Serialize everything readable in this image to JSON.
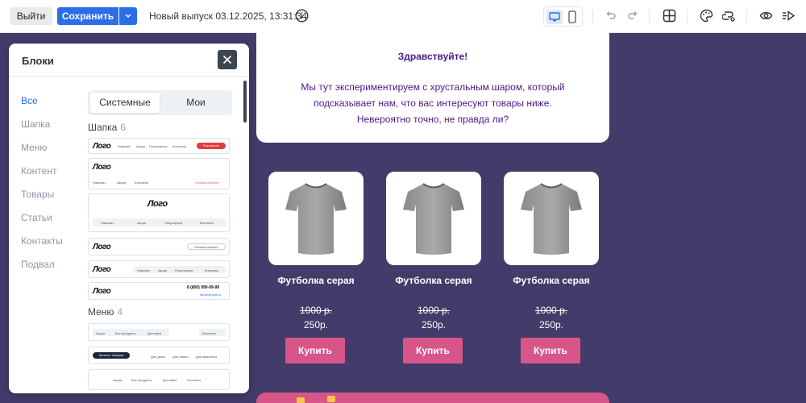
{
  "toolbar": {
    "exit_label": "Выйти",
    "save_label": "Сохранить",
    "version_text": "Новый выпуск 03.12.2025, 13:31:34"
  },
  "panel": {
    "title": "Блоки",
    "categories": [
      "Все",
      "Шапка",
      "Меню",
      "Контент",
      "Товары",
      "Статьи",
      "Контакты",
      "Подвал"
    ],
    "active_category": "Все",
    "tabs": [
      "Системные",
      "Мои"
    ],
    "active_tab": "Системные",
    "sections": [
      {
        "name": "Шапка",
        "count": "6"
      },
      {
        "name": "Меню",
        "count": "4"
      }
    ],
    "thumbs": {
      "logo": "Лого",
      "nav": [
        "Новинки",
        "Акции",
        "Популярное",
        "Контакты"
      ],
      "nav_short": [
        "Новинки",
        "Акции",
        "Контакты"
      ],
      "cta_red": "Popularnoe",
      "account": "Личный кабинет",
      "phone": "8 (800) 999-99-99",
      "email": "name@mail.ru",
      "menu1": [
        "Акции",
        "Все продукты",
        "Доставка",
        "Контакты"
      ],
      "catalog": "Каталог товаров",
      "menu2": [
        "Для дома",
        "Для семьи",
        "Для животных"
      ],
      "menu3": [
        "Акции",
        "Все продукты",
        "Доставка",
        "Контакты"
      ]
    }
  },
  "email": {
    "greeting_title": "Здравствуйте!",
    "greeting_body": "Мы тут экспериментируем с хрустальным шаром, который подсказывает нам, что вас интересуют товары ниже. Невероятно точно, не правда ли?",
    "products": [
      {
        "name": "Футболка серая",
        "old_price": "1000 р.",
        "new_price": "250р.",
        "button": "Купить"
      },
      {
        "name": "Футболка серая",
        "old_price": "1000 р.",
        "new_price": "250р.",
        "button": "Купить"
      },
      {
        "name": "Футболка серая",
        "old_price": "1000 р.",
        "new_price": "250р.",
        "button": "Купить"
      }
    ]
  },
  "colors": {
    "canvas_bg": "#433b69",
    "accent_blue": "#2b6ee8",
    "buy_button": "#d8558a",
    "greeting_text": "#4a1a8c"
  }
}
